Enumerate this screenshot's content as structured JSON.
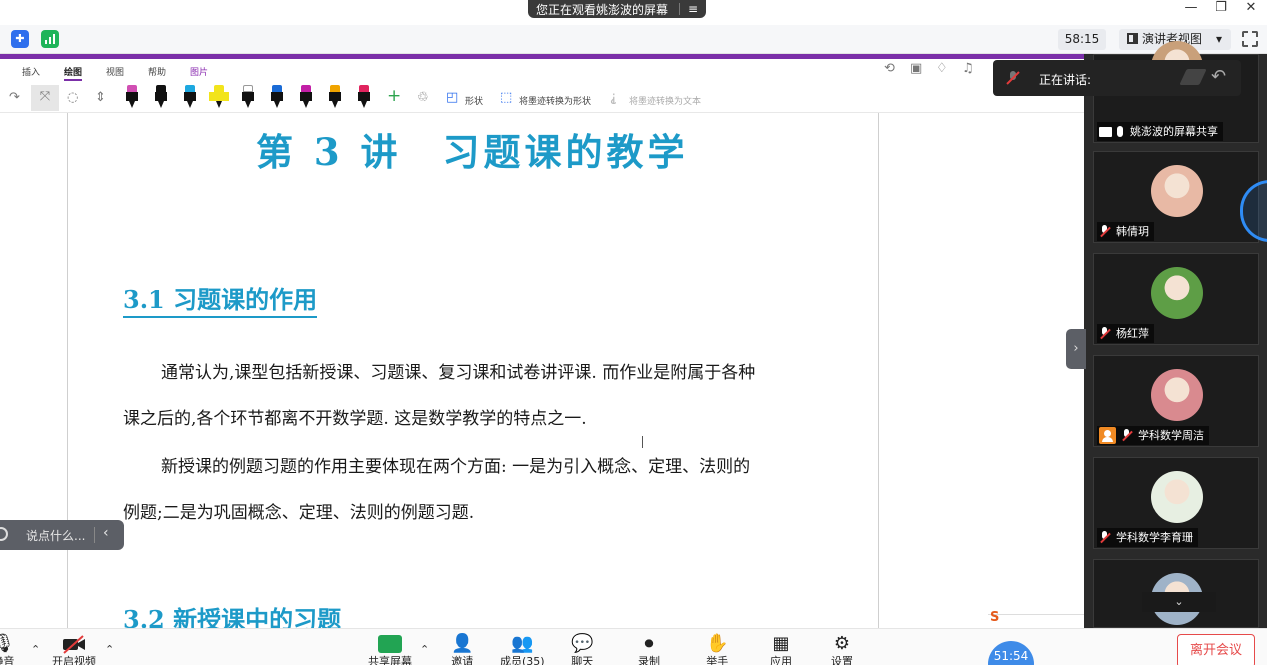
{
  "top_bar": {
    "share_status": "您正在观看姚澎波的屏幕",
    "share_menu_icon": "≡",
    "minimize": "—",
    "restore": "❐",
    "close": "✕"
  },
  "meeting_bar": {
    "timer": "58:15",
    "view_mode": "演讲者视图",
    "view_caret": "▾"
  },
  "onenote": {
    "tabs": [
      "插入",
      "绘图",
      "视图",
      "帮助",
      "图片"
    ],
    "active_tab": "绘图",
    "tools": {
      "shape": "形状",
      "ink_to_shape": "将墨迹转换为形状",
      "ink_to_text": "将墨迹转换为文本"
    },
    "pen_colors": [
      "#d14fb3",
      "#111111",
      "#1da8e0",
      "#f2e41c",
      "#ffffff",
      "#1a6bd6",
      "#c21fa6",
      "#f0a400",
      "#e0245e"
    ]
  },
  "document": {
    "lecture_title": "第 3 讲　习题课的教学",
    "section1": "3.1  习题课的作用",
    "p1_line1": "通常认为,课型包括新授课、习题课、复习课和试卷讲评课. 而作业是附属于各种",
    "p1_line2": "课之后的,各个环节都离不开数学题. 这是数学教学的特点之一.",
    "p2_line1": "新授课的例题习题的作用主要体现在两个方面: 一是为引入概念、定理、法则的",
    "p2_line2": "例题;二是为巩固概念、定理、法则的例题习题.",
    "section2": "3.2  新授课中的习题"
  },
  "chat_float": {
    "placeholder": "说点什么...",
    "collapse": "‹"
  },
  "speaking": {
    "label": "正在讲话:"
  },
  "participants": [
    {
      "name": "姚澎波的屏幕共享",
      "type": "screen",
      "avatar": "#c9a07a"
    },
    {
      "name": "韩倩玥",
      "type": "muted",
      "avatar": "#e8b9a5"
    },
    {
      "name": "杨红萍",
      "type": "muted",
      "avatar": "#5e9e46"
    },
    {
      "name": "学科数学周洁",
      "type": "muted-badge",
      "avatar": "#d98a8f"
    },
    {
      "name": "学科数学李育珊",
      "type": "muted",
      "avatar": "#e7efe2"
    },
    {
      "name": "",
      "type": "partial",
      "avatar": "#9fb3c8"
    }
  ],
  "bottom": {
    "mute": "静音",
    "video": "开启视频",
    "share": "共享屏幕",
    "invite": "邀请",
    "members": "成员(35)",
    "chat": "聊天",
    "record": "录制",
    "raise": "举手",
    "apps": "应用",
    "settings": "设置",
    "net_time": "51:54",
    "leave": "离开会议"
  },
  "colors": {
    "accent_purple": "#7b2fa8",
    "heading_blue": "#1d9ac8",
    "leave_red": "#e64a4a"
  }
}
